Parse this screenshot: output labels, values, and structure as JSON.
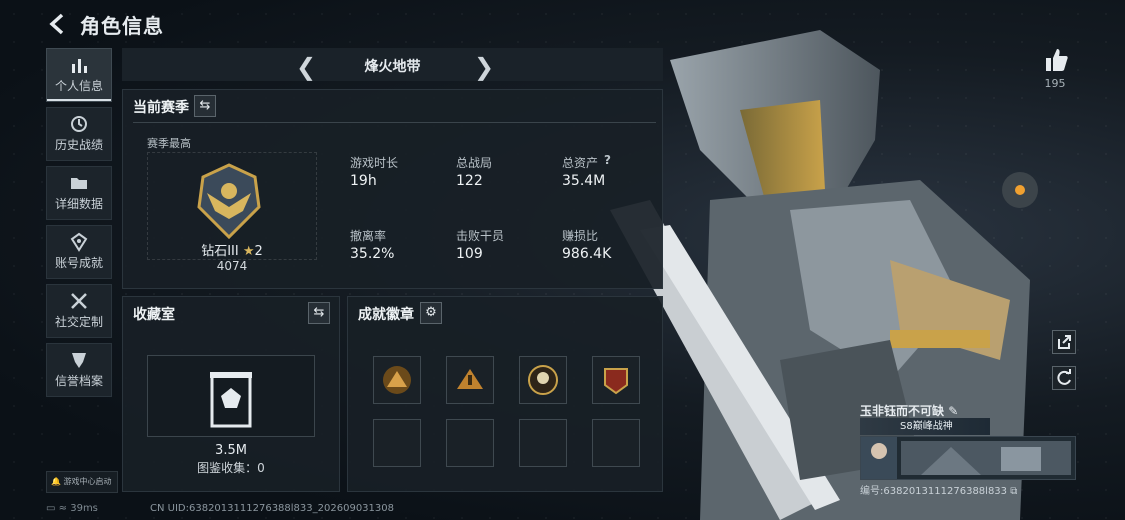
{
  "header": {
    "title": "角色信息"
  },
  "sidebar": {
    "items": [
      {
        "label": "个人信息",
        "icon": "bar-chart-icon"
      },
      {
        "label": "历史战绩",
        "icon": "history-icon"
      },
      {
        "label": "详细数据",
        "icon": "folder-icon"
      },
      {
        "label": "账号成就",
        "icon": "achievement-icon"
      },
      {
        "label": "社交定制",
        "icon": "tools-icon"
      },
      {
        "label": "信誉档案",
        "icon": "shield-icon"
      }
    ]
  },
  "season": {
    "name": "烽火地带",
    "current_label": "当前赛季",
    "best_label": "赛季最高",
    "rank_name": "钻石III",
    "rank_stars": "2",
    "rank_score": "4074",
    "stats": [
      {
        "label": "游戏时长",
        "value": "19h"
      },
      {
        "label": "总战局",
        "value": "122"
      },
      {
        "label": "总资产",
        "value": "35.4M",
        "help": "?"
      },
      {
        "label": "撤离率",
        "value": "35.2%"
      },
      {
        "label": "击败干员",
        "value": "109"
      },
      {
        "label": "赚损比",
        "value": "986.4K"
      }
    ]
  },
  "collection": {
    "title": "收藏室",
    "value": "3.5M",
    "sub": "图鉴收集：0"
  },
  "badges": {
    "title": "成就徽章"
  },
  "profile": {
    "likes": "195",
    "player_name": "玉非钰而不可缺",
    "player_title": "S8巅峰战神",
    "player_id": "编号:6382013111276388l833"
  },
  "footer": {
    "ping": "39ms",
    "uid": "CN UID:6382013111276388l833_202609031308",
    "game_center": "游戏中心启动"
  },
  "colors": {
    "accent": "#d8e0e6",
    "panel": "#181f26",
    "gold": "#c9a24a"
  }
}
